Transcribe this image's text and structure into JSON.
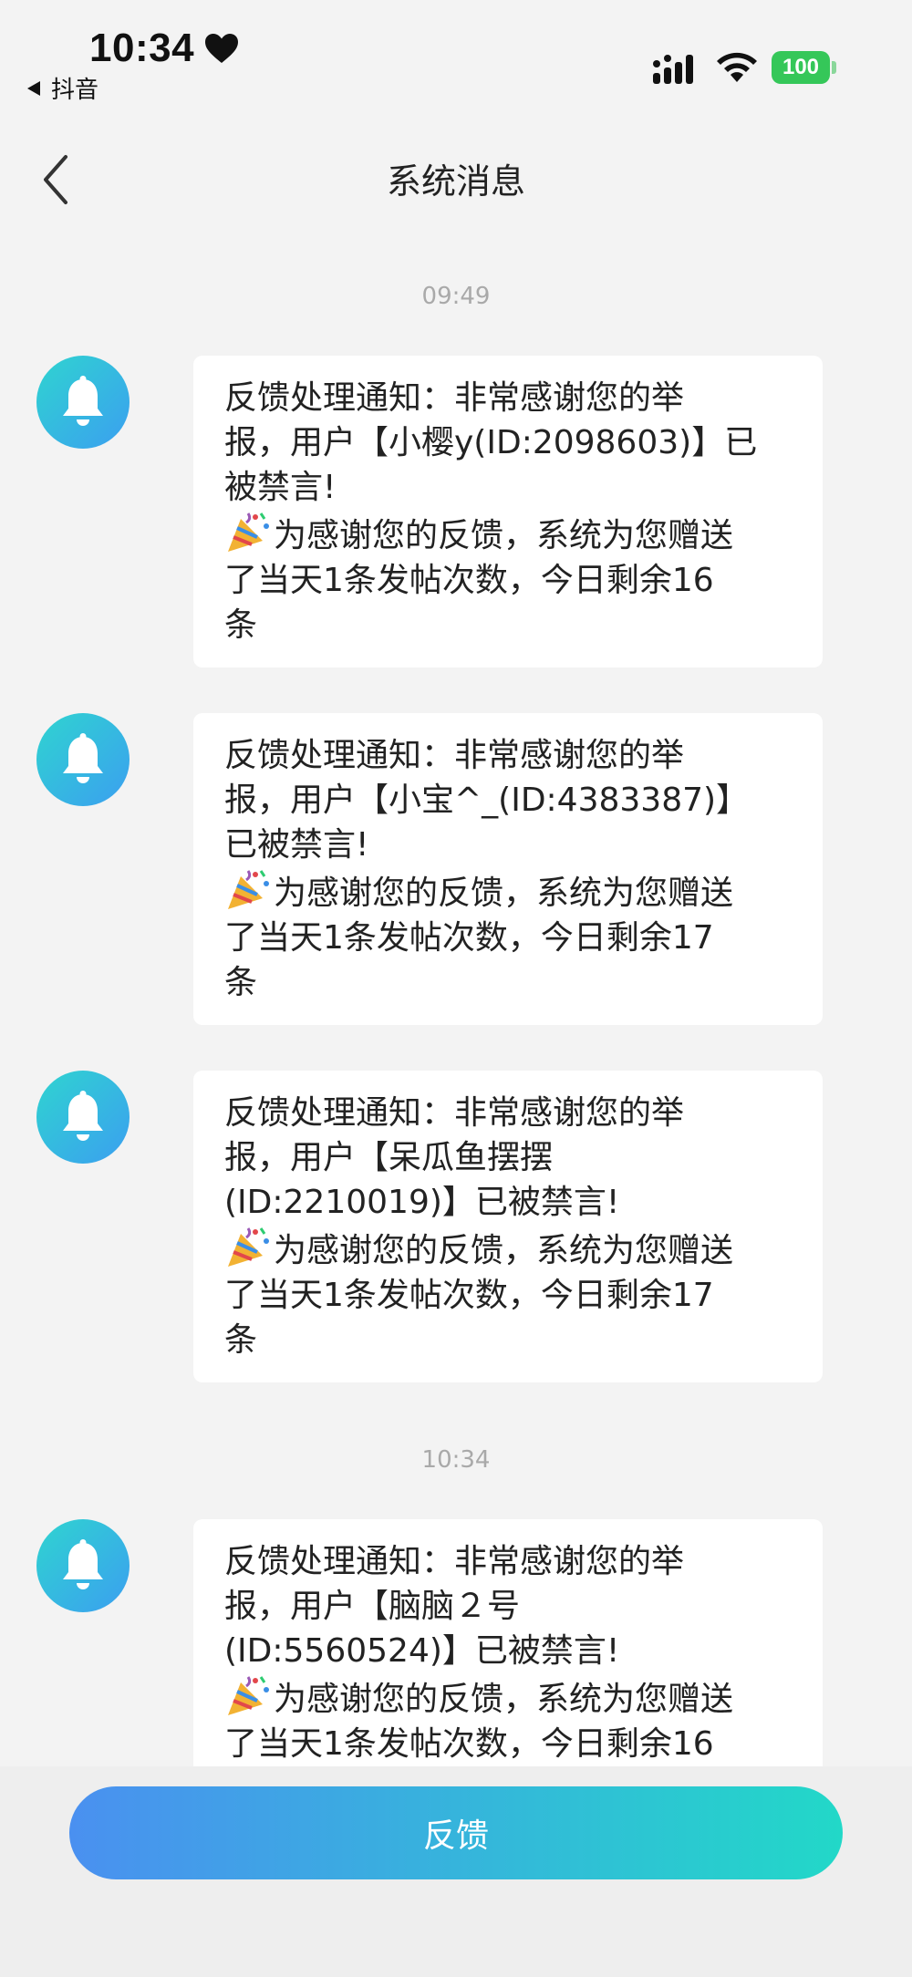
{
  "status_bar": {
    "time": "10:34",
    "back_app": "抖音",
    "battery": "100",
    "colors": {
      "battery": "#35c759"
    }
  },
  "nav": {
    "title": "系统消息"
  },
  "groups": [
    {
      "time": "09:49",
      "messages": [
        {
          "line1": "反馈处理通知：非常感谢您的举",
          "line2": "报，用户【小樱y(ID:2098603)】已",
          "line3": "被禁言!",
          "line4": "为感谢您的反馈，系统为您赠送",
          "line5": "了当天1条发帖次数，今日剩余16",
          "line6": "条"
        },
        {
          "line1": "反馈处理通知：非常感谢您的举",
          "line2": "报，用户【小宝^_(ID:4383387)】",
          "line3": "已被禁言!",
          "line4": "为感谢您的反馈，系统为您赠送",
          "line5": "了当天1条发帖次数，今日剩余17",
          "line6": "条"
        },
        {
          "line1": "反馈处理通知：非常感谢您的举",
          "line2": "报，用户【呆瓜鱼摆摆",
          "line3": "(ID:2210019)】已被禁言!",
          "line4": "为感谢您的反馈，系统为您赠送",
          "line5": "了当天1条发帖次数，今日剩余17",
          "line6": "条"
        }
      ]
    },
    {
      "time": "10:34",
      "messages": [
        {
          "line1": "反馈处理通知：非常感谢您的举",
          "line2": "报，用户【脑脑２号",
          "line3": "(ID:5560524)】已被禁言!",
          "line4": "为感谢您的反馈，系统为您赠送",
          "line5": "了当天1条发帖次数，今日剩余16",
          "line6": ""
        }
      ]
    }
  ],
  "bottom": {
    "feedback_label": "反馈"
  },
  "icons": {
    "avatar": "bell-icon",
    "emoji": "party-popper-icon",
    "back": "chevron-left-icon"
  }
}
